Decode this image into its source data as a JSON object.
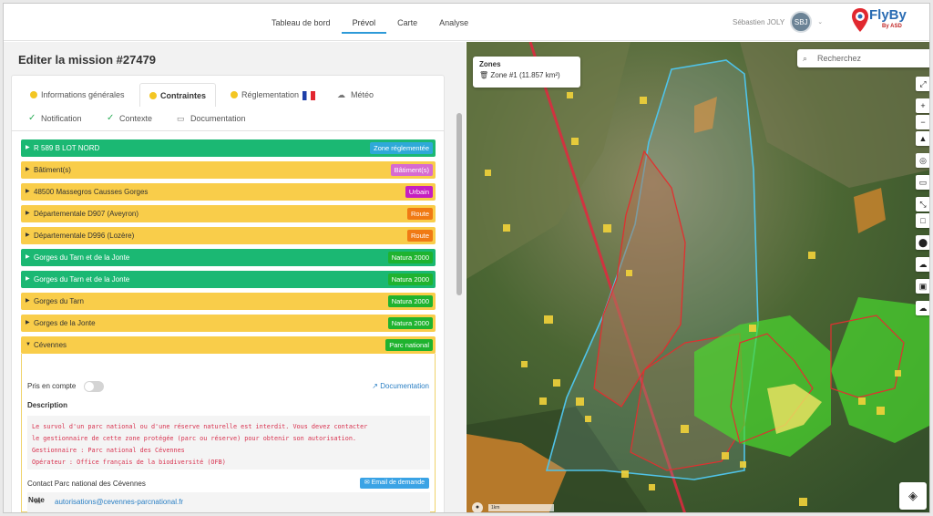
{
  "nav": {
    "items": [
      "Tableau de bord",
      "Prévol",
      "Carte",
      "Analyse"
    ],
    "active": "Prévol"
  },
  "user": {
    "name": "Sébastien JOLY",
    "initials": "SBJ"
  },
  "brand": {
    "name": "FlyBy",
    "sub": "By ASD"
  },
  "page": {
    "title": "Editer la mission #27479"
  },
  "tabs": {
    "general": "Informations générales",
    "constraints": "Contraintes",
    "regulation": "Réglementation",
    "weather": "Météo",
    "notification": "Notification",
    "context": "Contexte",
    "documentation": "Documentation"
  },
  "zones": [
    {
      "label": "R 589 B LOT NORD",
      "badge": "Zone réglementée",
      "row": "green",
      "badge_color": "#2fa9d8"
    },
    {
      "label": "Bâtiment(s)",
      "badge": "Bâtiment(s)",
      "row": "yellow",
      "badge_color": "#d76ad0"
    },
    {
      "label": "48500 Massegros Causses Gorges",
      "badge": "Urbain",
      "row": "yellow",
      "badge_color": "#c51fc0"
    },
    {
      "label": "Départementale D907 (Aveyron)",
      "badge": "Route",
      "row": "yellow",
      "badge_color": "#f07a14"
    },
    {
      "label": "Départementale D996 (Lozère)",
      "badge": "Route",
      "row": "yellow",
      "badge_color": "#f07a14"
    },
    {
      "label": "Gorges du Tarn et de la Jonte",
      "badge": "Natura 2000",
      "row": "green",
      "badge_color": "#1fb32f"
    },
    {
      "label": "Gorges du Tarn et de la Jonte",
      "badge": "Natura 2000",
      "row": "green",
      "badge_color": "#1fb32f"
    },
    {
      "label": "Gorges du Tarn",
      "badge": "Natura 2000",
      "row": "yellow",
      "badge_color": "#1fb32f"
    },
    {
      "label": "Gorges de la Jonte",
      "badge": "Natura 2000",
      "row": "yellow",
      "badge_color": "#1fb32f"
    }
  ],
  "expanded": {
    "label": "Cévennes",
    "badge": "Parc national",
    "badge_color": "#1fb32f",
    "taken_label": "Pris en compte",
    "doc_link": "Documentation",
    "desc_label": "Description",
    "desc_lines": [
      "Le survol d'un parc national ou d'une réserve naturelle est interdit. Vous devez contacter",
      "le gestionnaire de cette zone protégée (parc ou réserve) pour obtenir son autorisation.",
      "Gestionnaire : Parc national des Cévennes",
      "Opérateur : Office français de la biodiversité (OFB)"
    ],
    "contact_label": "Contact Parc national des Cévennes",
    "email_button": "Email de demande",
    "email": "autorisations@cevennes-parcnational.fr"
  },
  "note_label": "Note",
  "map": {
    "zones_title": "Zones",
    "zone_item": "Zone #1 (11.857 km²)",
    "search_placeholder": "Recherchez",
    "scale": "1km",
    "controls": [
      "fullscreen-icon",
      "zoom-in-icon",
      "zoom-out-icon",
      "compass-icon",
      "locate-icon",
      "ruler-icon",
      "measure-icon",
      "polygon-icon",
      "marker-icon",
      "upload-icon",
      "image-icon",
      "download-icon",
      "layers-icon"
    ]
  }
}
